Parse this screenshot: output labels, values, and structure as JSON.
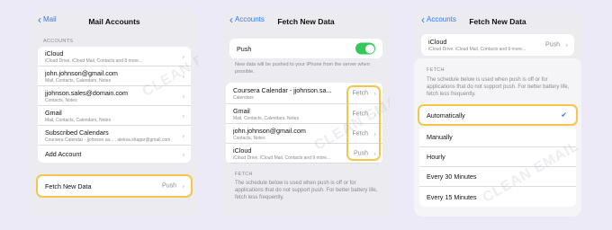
{
  "phone1": {
    "back": "Mail",
    "title": "Mail Accounts",
    "section": "ACCOUNTS",
    "accounts": [
      {
        "title": "iCloud",
        "subtitle": "iCloud Drive, iCloud Mail, Contacts and 8 more..."
      },
      {
        "title": "john.johnson@gmail.com",
        "subtitle": "Mail, Contacts, Calendars, Notes"
      },
      {
        "title": "jjohnson.sales@domain.com",
        "subtitle": "Contacts, Notes"
      },
      {
        "title": "Gmail",
        "subtitle": "Mail, Contacts, Calendars, Notes"
      },
      {
        "title": "Subscribed Calendars",
        "subtitle": "Coursera Calendar - jjohnson.sa... , aleksa.shagar@gmail.com"
      },
      {
        "title": "Add Account",
        "subtitle": ""
      }
    ],
    "fetch": {
      "label": "Fetch New Data",
      "value": "Push"
    },
    "watermark": "CLEAN EMAIL"
  },
  "phone2": {
    "back": "Accounts",
    "title": "Fetch New Data",
    "push_label": "Push",
    "push_note": "New data will be pushed to your iPhone from the server when possible.",
    "accounts": [
      {
        "title": "Coursera Calendar - jjohnson.sa...",
        "subtitle": "Calendars",
        "value": "Fetch"
      },
      {
        "title": "Gmail",
        "subtitle": "Mail, Contacts, Calendars, Notes",
        "value": "Fetch"
      },
      {
        "title": "john.johnson@gmail.com",
        "subtitle": "Contacts, Notes",
        "value": "Fetch"
      },
      {
        "title": "iCloud",
        "subtitle": "iCloud Drive, iCloud Mail, Contacts and 9 more...",
        "value": "Push"
      }
    ],
    "fetch_section": "FETCH",
    "fetch_note": "The schedule below is used when push is off or for applications that do not support push. For better battery life, fetch less frequently.",
    "watermark": "CLEAN EMAIL"
  },
  "phone3": {
    "back": "Accounts",
    "title": "Fetch New Data",
    "icloud": {
      "title": "iCloud",
      "subtitle": "iCloud Drive, iCloud Mail, Contacts and 9 more...",
      "value": "Push"
    },
    "fetch_section": "FETCH",
    "fetch_note": "The schedule below is used when push is off or for applications that do not support push. For better battery life, fetch less frequently.",
    "options": [
      "Automatically",
      "Manually",
      "Hourly",
      "Every 30 Minutes",
      "Every 15 Minutes"
    ],
    "watermark": "CLEAN EMAIL"
  },
  "colors": {
    "accent": "#2f7bf5",
    "highlight": "#f5c64b",
    "toggle_on": "#34c759"
  }
}
